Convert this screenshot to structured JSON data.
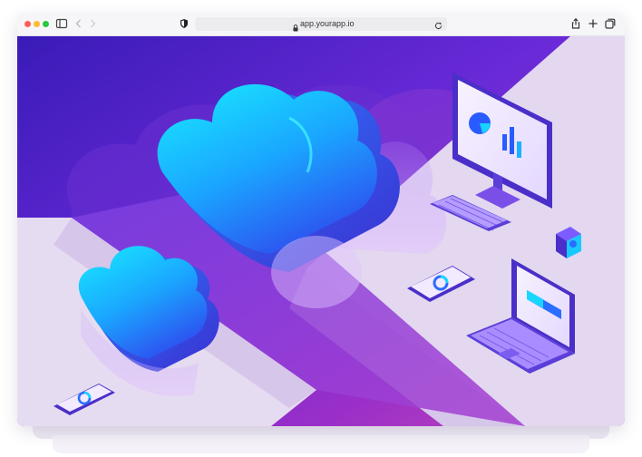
{
  "browser": {
    "url": "app.yourapp.io"
  },
  "colors": {
    "accent_purple": "#5b2fd0",
    "cloud_cyan": "#19d6ff",
    "cloud_blue": "#2a6dff",
    "desk_lavender": "#e3d8ef"
  },
  "icons": [
    "sidebar-icon",
    "back-icon",
    "forward-icon",
    "shield-icon",
    "lock-icon",
    "reload-icon",
    "share-icon",
    "new-tab-icon",
    "tabs-overview-icon"
  ],
  "illustration": {
    "subjects": [
      "cloud",
      "monitor",
      "keyboard",
      "tablet",
      "laptop",
      "cube"
    ]
  }
}
